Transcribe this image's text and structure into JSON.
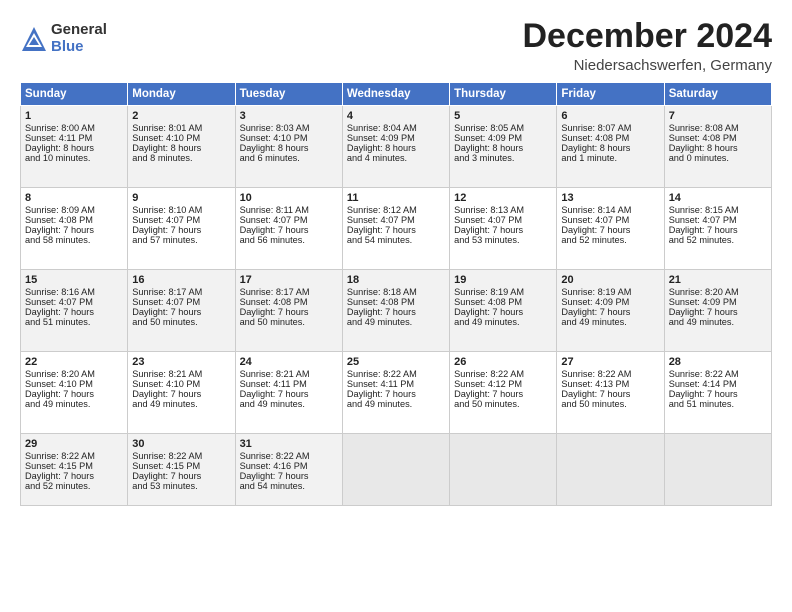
{
  "header": {
    "logo_line1": "General",
    "logo_line2": "Blue",
    "month": "December 2024",
    "location": "Niedersachswerfen, Germany"
  },
  "weekdays": [
    "Sunday",
    "Monday",
    "Tuesday",
    "Wednesday",
    "Thursday",
    "Friday",
    "Saturday"
  ],
  "weeks": [
    [
      {
        "day": "1",
        "lines": [
          "Sunrise: 8:00 AM",
          "Sunset: 4:11 PM",
          "Daylight: 8 hours",
          "and 10 minutes."
        ]
      },
      {
        "day": "2",
        "lines": [
          "Sunrise: 8:01 AM",
          "Sunset: 4:10 PM",
          "Daylight: 8 hours",
          "and 8 minutes."
        ]
      },
      {
        "day": "3",
        "lines": [
          "Sunrise: 8:03 AM",
          "Sunset: 4:10 PM",
          "Daylight: 8 hours",
          "and 6 minutes."
        ]
      },
      {
        "day": "4",
        "lines": [
          "Sunrise: 8:04 AM",
          "Sunset: 4:09 PM",
          "Daylight: 8 hours",
          "and 4 minutes."
        ]
      },
      {
        "day": "5",
        "lines": [
          "Sunrise: 8:05 AM",
          "Sunset: 4:09 PM",
          "Daylight: 8 hours",
          "and 3 minutes."
        ]
      },
      {
        "day": "6",
        "lines": [
          "Sunrise: 8:07 AM",
          "Sunset: 4:08 PM",
          "Daylight: 8 hours",
          "and 1 minute."
        ]
      },
      {
        "day": "7",
        "lines": [
          "Sunrise: 8:08 AM",
          "Sunset: 4:08 PM",
          "Daylight: 8 hours",
          "and 0 minutes."
        ]
      }
    ],
    [
      {
        "day": "8",
        "lines": [
          "Sunrise: 8:09 AM",
          "Sunset: 4:08 PM",
          "Daylight: 7 hours",
          "and 58 minutes."
        ]
      },
      {
        "day": "9",
        "lines": [
          "Sunrise: 8:10 AM",
          "Sunset: 4:07 PM",
          "Daylight: 7 hours",
          "and 57 minutes."
        ]
      },
      {
        "day": "10",
        "lines": [
          "Sunrise: 8:11 AM",
          "Sunset: 4:07 PM",
          "Daylight: 7 hours",
          "and 56 minutes."
        ]
      },
      {
        "day": "11",
        "lines": [
          "Sunrise: 8:12 AM",
          "Sunset: 4:07 PM",
          "Daylight: 7 hours",
          "and 54 minutes."
        ]
      },
      {
        "day": "12",
        "lines": [
          "Sunrise: 8:13 AM",
          "Sunset: 4:07 PM",
          "Daylight: 7 hours",
          "and 53 minutes."
        ]
      },
      {
        "day": "13",
        "lines": [
          "Sunrise: 8:14 AM",
          "Sunset: 4:07 PM",
          "Daylight: 7 hours",
          "and 52 minutes."
        ]
      },
      {
        "day": "14",
        "lines": [
          "Sunrise: 8:15 AM",
          "Sunset: 4:07 PM",
          "Daylight: 7 hours",
          "and 52 minutes."
        ]
      }
    ],
    [
      {
        "day": "15",
        "lines": [
          "Sunrise: 8:16 AM",
          "Sunset: 4:07 PM",
          "Daylight: 7 hours",
          "and 51 minutes."
        ]
      },
      {
        "day": "16",
        "lines": [
          "Sunrise: 8:17 AM",
          "Sunset: 4:07 PM",
          "Daylight: 7 hours",
          "and 50 minutes."
        ]
      },
      {
        "day": "17",
        "lines": [
          "Sunrise: 8:17 AM",
          "Sunset: 4:08 PM",
          "Daylight: 7 hours",
          "and 50 minutes."
        ]
      },
      {
        "day": "18",
        "lines": [
          "Sunrise: 8:18 AM",
          "Sunset: 4:08 PM",
          "Daylight: 7 hours",
          "and 49 minutes."
        ]
      },
      {
        "day": "19",
        "lines": [
          "Sunrise: 8:19 AM",
          "Sunset: 4:08 PM",
          "Daylight: 7 hours",
          "and 49 minutes."
        ]
      },
      {
        "day": "20",
        "lines": [
          "Sunrise: 8:19 AM",
          "Sunset: 4:09 PM",
          "Daylight: 7 hours",
          "and 49 minutes."
        ]
      },
      {
        "day": "21",
        "lines": [
          "Sunrise: 8:20 AM",
          "Sunset: 4:09 PM",
          "Daylight: 7 hours",
          "and 49 minutes."
        ]
      }
    ],
    [
      {
        "day": "22",
        "lines": [
          "Sunrise: 8:20 AM",
          "Sunset: 4:10 PM",
          "Daylight: 7 hours",
          "and 49 minutes."
        ]
      },
      {
        "day": "23",
        "lines": [
          "Sunrise: 8:21 AM",
          "Sunset: 4:10 PM",
          "Daylight: 7 hours",
          "and 49 minutes."
        ]
      },
      {
        "day": "24",
        "lines": [
          "Sunrise: 8:21 AM",
          "Sunset: 4:11 PM",
          "Daylight: 7 hours",
          "and 49 minutes."
        ]
      },
      {
        "day": "25",
        "lines": [
          "Sunrise: 8:22 AM",
          "Sunset: 4:11 PM",
          "Daylight: 7 hours",
          "and 49 minutes."
        ]
      },
      {
        "day": "26",
        "lines": [
          "Sunrise: 8:22 AM",
          "Sunset: 4:12 PM",
          "Daylight: 7 hours",
          "and 50 minutes."
        ]
      },
      {
        "day": "27",
        "lines": [
          "Sunrise: 8:22 AM",
          "Sunset: 4:13 PM",
          "Daylight: 7 hours",
          "and 50 minutes."
        ]
      },
      {
        "day": "28",
        "lines": [
          "Sunrise: 8:22 AM",
          "Sunset: 4:14 PM",
          "Daylight: 7 hours",
          "and 51 minutes."
        ]
      }
    ],
    [
      {
        "day": "29",
        "lines": [
          "Sunrise: 8:22 AM",
          "Sunset: 4:15 PM",
          "Daylight: 7 hours",
          "and 52 minutes."
        ]
      },
      {
        "day": "30",
        "lines": [
          "Sunrise: 8:22 AM",
          "Sunset: 4:15 PM",
          "Daylight: 7 hours",
          "and 53 minutes."
        ]
      },
      {
        "day": "31",
        "lines": [
          "Sunrise: 8:22 AM",
          "Sunset: 4:16 PM",
          "Daylight: 7 hours",
          "and 54 minutes."
        ]
      },
      null,
      null,
      null,
      null
    ]
  ]
}
